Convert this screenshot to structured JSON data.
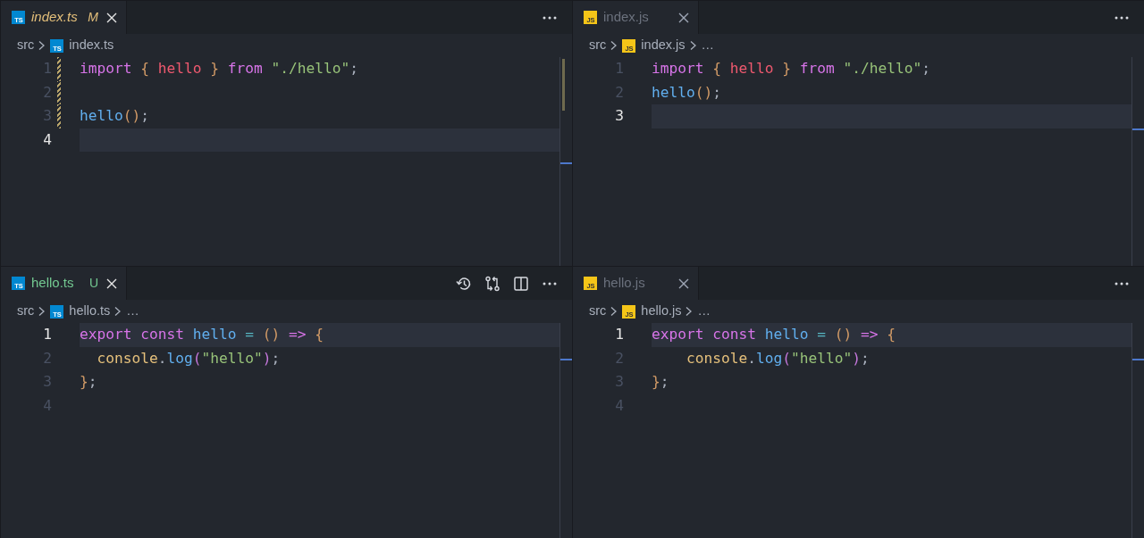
{
  "panes": [
    {
      "tab": {
        "label": "index.ts",
        "kind": "ts",
        "file_glyph": "TS",
        "italic": true,
        "modified": true,
        "untracked": false,
        "badge": "M",
        "group_active": true
      },
      "actions": [
        {
          "kind": "more"
        }
      ],
      "breadcrumbs": [
        {
          "label": "src"
        },
        {
          "label": "index.ts",
          "kind": "ts",
          "file_glyph": "TS"
        }
      ],
      "lines": [
        {
          "number": "1",
          "current": false,
          "changed": true,
          "tokens": [
            {
              "t": "import ",
              "kind": "keyword"
            },
            {
              "t": "{ ",
              "kind": "brace"
            },
            {
              "t": "hello ",
              "kind": "variable"
            },
            {
              "t": "} ",
              "kind": "brace"
            },
            {
              "t": "from ",
              "kind": "keyword"
            },
            {
              "t": "\"./hello\"",
              "kind": "string"
            },
            {
              "t": ";",
              "kind": "punct"
            }
          ]
        },
        {
          "number": "2",
          "current": false,
          "changed": true
        },
        {
          "number": "3",
          "current": false,
          "changed": true,
          "tokens": [
            {
              "t": "hello",
              "kind": "function"
            },
            {
              "t": "()",
              "kind": "brace"
            },
            {
              "t": ";",
              "kind": "punct"
            }
          ]
        },
        {
          "number": "4",
          "current": true,
          "changed": false
        }
      ]
    },
    {
      "tab": {
        "label": "index.js",
        "kind": "js",
        "file_glyph": "JS",
        "italic": false,
        "modified": false,
        "untracked": false,
        "group_active": false
      },
      "actions": [
        {
          "kind": "more"
        }
      ],
      "breadcrumbs": [
        {
          "label": "src"
        },
        {
          "label": "index.js",
          "kind": "js",
          "file_glyph": "JS"
        },
        {
          "label": "…"
        }
      ],
      "lines": [
        {
          "number": "1",
          "current": false,
          "tokens": [
            {
              "t": "import ",
              "kind": "keyword"
            },
            {
              "t": "{ ",
              "kind": "brace"
            },
            {
              "t": "hello ",
              "kind": "variable"
            },
            {
              "t": "} ",
              "kind": "brace"
            },
            {
              "t": "from ",
              "kind": "keyword"
            },
            {
              "t": "\"./hello\"",
              "kind": "string"
            },
            {
              "t": ";",
              "kind": "punct"
            }
          ]
        },
        {
          "number": "2",
          "current": false,
          "tokens": [
            {
              "t": "hello",
              "kind": "function"
            },
            {
              "t": "()",
              "kind": "brace"
            },
            {
              "t": ";",
              "kind": "punct"
            }
          ]
        },
        {
          "number": "3",
          "current": true
        }
      ]
    },
    {
      "tab": {
        "label": "hello.ts",
        "kind": "ts",
        "file_glyph": "TS",
        "italic": false,
        "modified": false,
        "untracked": true,
        "badge": "U",
        "group_active": true
      },
      "actions": [
        {
          "kind": "history"
        },
        {
          "kind": "compare"
        },
        {
          "kind": "split"
        },
        {
          "kind": "more"
        }
      ],
      "breadcrumbs": [
        {
          "label": "src"
        },
        {
          "label": "hello.ts",
          "kind": "ts",
          "file_glyph": "TS"
        },
        {
          "label": "…"
        }
      ],
      "lines": [
        {
          "number": "1",
          "current": true,
          "tokens": [
            {
              "t": "export ",
              "kind": "keyword"
            },
            {
              "t": "const ",
              "kind": "keyword"
            },
            {
              "t": "hello ",
              "kind": "function"
            },
            {
              "t": "= ",
              "kind": "operator"
            },
            {
              "t": "() ",
              "kind": "brace"
            },
            {
              "t": "=> ",
              "kind": "keyword"
            },
            {
              "t": "{",
              "kind": "brace"
            }
          ]
        },
        {
          "number": "2",
          "current": false,
          "tokens": [
            {
              "t": "  console",
              "kind": "object"
            },
            {
              "t": ".",
              "kind": "punct"
            },
            {
              "t": "log",
              "kind": "function"
            },
            {
              "t": "(",
              "kind": "paren"
            },
            {
              "t": "\"hello\"",
              "kind": "string"
            },
            {
              "t": ")",
              "kind": "paren"
            },
            {
              "t": ";",
              "kind": "punct"
            }
          ]
        },
        {
          "number": "3",
          "current": false,
          "tokens": [
            {
              "t": "}",
              "kind": "brace"
            },
            {
              "t": ";",
              "kind": "punct"
            }
          ]
        },
        {
          "number": "4",
          "current": false
        }
      ]
    },
    {
      "tab": {
        "label": "hello.js",
        "kind": "js",
        "file_glyph": "JS",
        "italic": false,
        "modified": false,
        "untracked": false,
        "group_active": false
      },
      "actions": [
        {
          "kind": "more"
        }
      ],
      "breadcrumbs": [
        {
          "label": "src"
        },
        {
          "label": "hello.js",
          "kind": "js",
          "file_glyph": "JS"
        },
        {
          "label": "…"
        }
      ],
      "lines": [
        {
          "number": "1",
          "current": true,
          "tokens": [
            {
              "t": "export ",
              "kind": "keyword"
            },
            {
              "t": "const ",
              "kind": "keyword"
            },
            {
              "t": "hello ",
              "kind": "function"
            },
            {
              "t": "= ",
              "kind": "operator"
            },
            {
              "t": "() ",
              "kind": "brace"
            },
            {
              "t": "=> ",
              "kind": "keyword"
            },
            {
              "t": "{",
              "kind": "brace"
            }
          ]
        },
        {
          "number": "2",
          "current": false,
          "tokens": [
            {
              "t": "    console",
              "kind": "object"
            },
            {
              "t": ".",
              "kind": "punct"
            },
            {
              "t": "log",
              "kind": "function"
            },
            {
              "t": "(",
              "kind": "paren"
            },
            {
              "t": "\"hello\"",
              "kind": "string"
            },
            {
              "t": ")",
              "kind": "paren"
            },
            {
              "t": ";",
              "kind": "punct"
            }
          ]
        },
        {
          "number": "3",
          "current": false,
          "tokens": [
            {
              "t": "}",
              "kind": "brace"
            },
            {
              "t": ";",
              "kind": "punct"
            }
          ]
        },
        {
          "number": "4",
          "current": false
        }
      ]
    }
  ]
}
